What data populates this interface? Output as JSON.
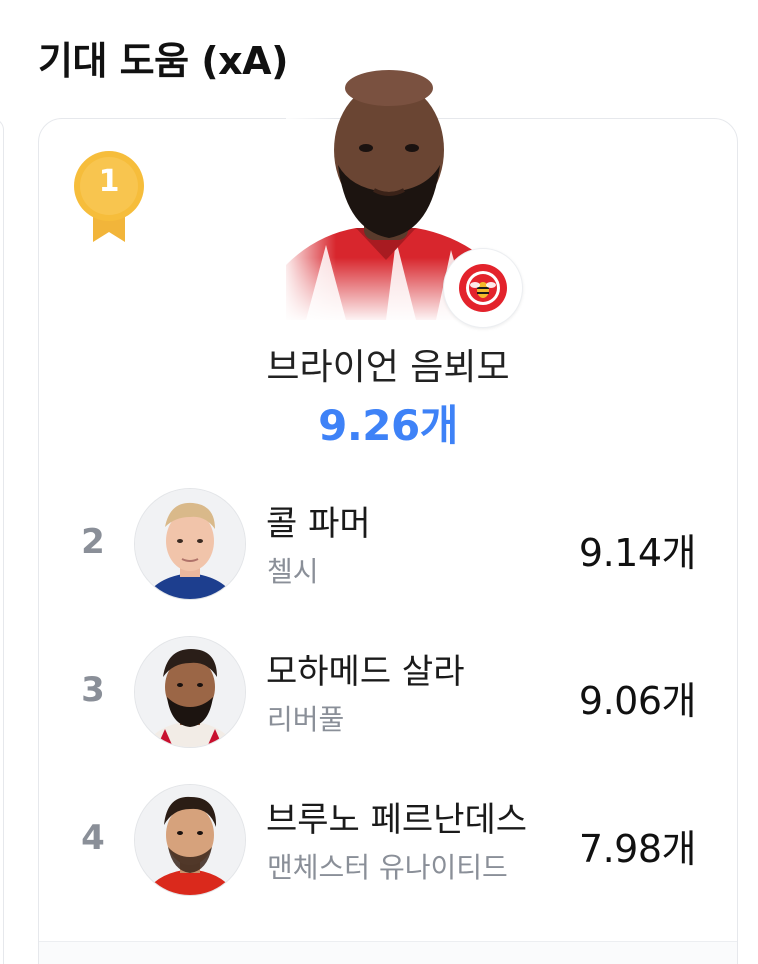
{
  "section": {
    "title": "기대 도움 (xA)"
  },
  "leader": {
    "rank": "1",
    "name": "브라이언 음뵈모",
    "value": "9.26개",
    "club_icon": "brentford-crest-icon"
  },
  "players": [
    {
      "rank": "2",
      "name": "콜 파머",
      "club": "첼시",
      "value": "9.14개"
    },
    {
      "rank": "3",
      "name": "모하메드 살라",
      "club": "리버풀",
      "value": "9.06개"
    },
    {
      "rank": "4",
      "name": "브루노 페르난데스",
      "club": "맨체스터 유나이티드",
      "value": "7.98개"
    }
  ],
  "colors": {
    "accent": "#3e82f7",
    "medal_gold": "#f6bd3b",
    "muted_text": "#8a8f98",
    "card_border": "#e6e8ec"
  }
}
